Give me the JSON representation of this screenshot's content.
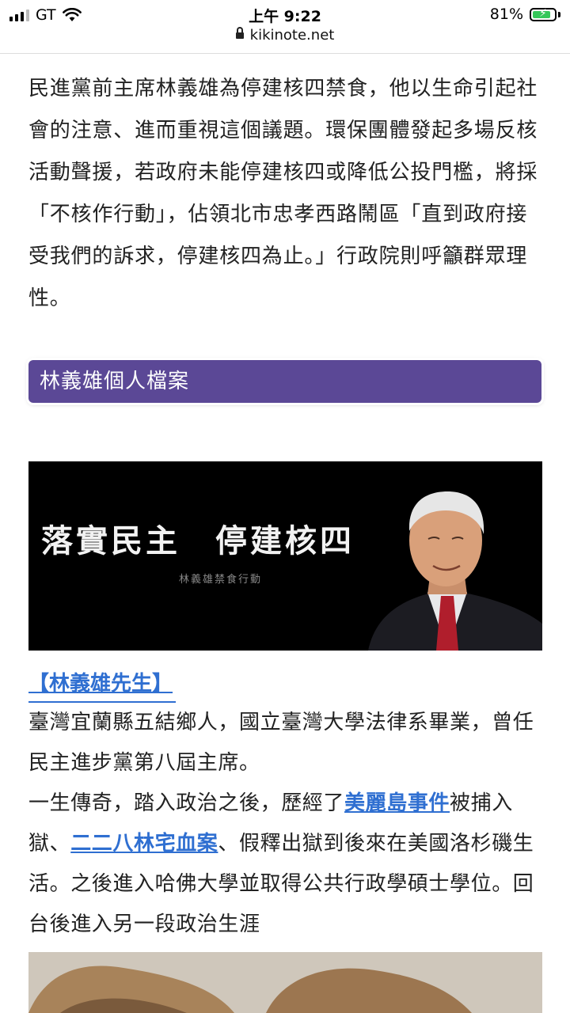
{
  "status_bar": {
    "carrier": "GT",
    "time": "上午 9:22",
    "battery_percent": "81%",
    "battery_level": 0.81,
    "signal_bars": 3
  },
  "url_bar": {
    "domain": "kikinote.net"
  },
  "article": {
    "intro_paragraph": "民進黨前主席林義雄為停建核四禁食，他以生命引起社會的注意、進而重視這個議題。環保團體發起多場反核活動聲援，若政府未能停建核四或降低公投門檻，將採「不核作行動」，佔領北市忠孝西路鬧區「直到政府接受我們的訴求，停建核四為止。」行政院則呼籲群眾理性。",
    "section_header": "林義雄個人檔案",
    "banner": {
      "title": "落實民主　停建核四",
      "subtitle": "林義雄禁食行動"
    },
    "bio": {
      "title_link": "【林義雄先生】",
      "line1": "臺灣宜蘭縣五結鄉人，國立臺灣大學法律系畢業，曾任民主進步黨第八屆主席。",
      "line2_part1": "一生傳奇，踏入政治之後，歷經了",
      "link1": "美麗島事件",
      "line2_part2": "被捕入獄、",
      "link2": "二二八林宅血案",
      "line2_part3": "、假釋出獄到後來在美國洛杉磯生活。之後進入哈佛大學並取得公共行政學碩士學位。回台後進入另一段政治生涯"
    }
  },
  "colors": {
    "section_header_bg": "#5b4896",
    "link": "#2f6fd1",
    "battery_fill": "#34c759"
  }
}
